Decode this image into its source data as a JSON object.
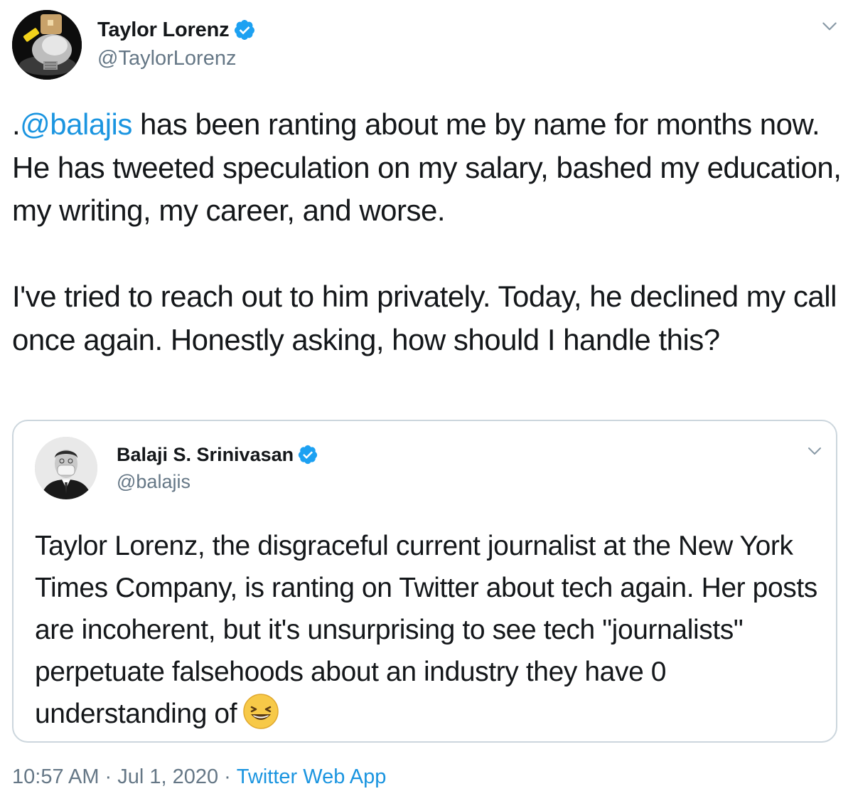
{
  "tweet": {
    "author": {
      "display_name": "Taylor Lorenz",
      "handle": "@TaylorLorenz",
      "verified": true
    },
    "text": {
      "prefix": ".",
      "mention": "@balajis",
      "paragraph1_rest": " has been ranting about me by name for months now. He has tweeted speculation on my salary, bashed my education, my writing, my career, and worse.",
      "paragraph2": "I've tried to reach out to him privately. Today, he declined my call once again. Honestly asking, how should I handle this?"
    },
    "quoted": {
      "author": {
        "display_name": "Balaji S. Srinivasan",
        "handle": "@balajis",
        "verified": true
      },
      "text": "Taylor Lorenz, the disgraceful current journalist at the New York Times Company, is ranting on Twitter about tech again. Her posts are incoherent, but it's unsurprising to see tech \"journalists\" perpetuate falsehoods about an industry they have 0 understanding of",
      "emoji": "grinning-squinting-face-emoji"
    },
    "meta": {
      "time": "10:57 AM",
      "separator": "·",
      "date": "Jul 1, 2020",
      "source": "Twitter Web App"
    }
  },
  "icons": {
    "verified": "verified-badge-icon",
    "caret": "chevron-down-icon"
  },
  "colors": {
    "link": "#1b95e0",
    "secondary_text": "#657786",
    "verified": "#1da1f2",
    "border": "#ccd6dd"
  }
}
